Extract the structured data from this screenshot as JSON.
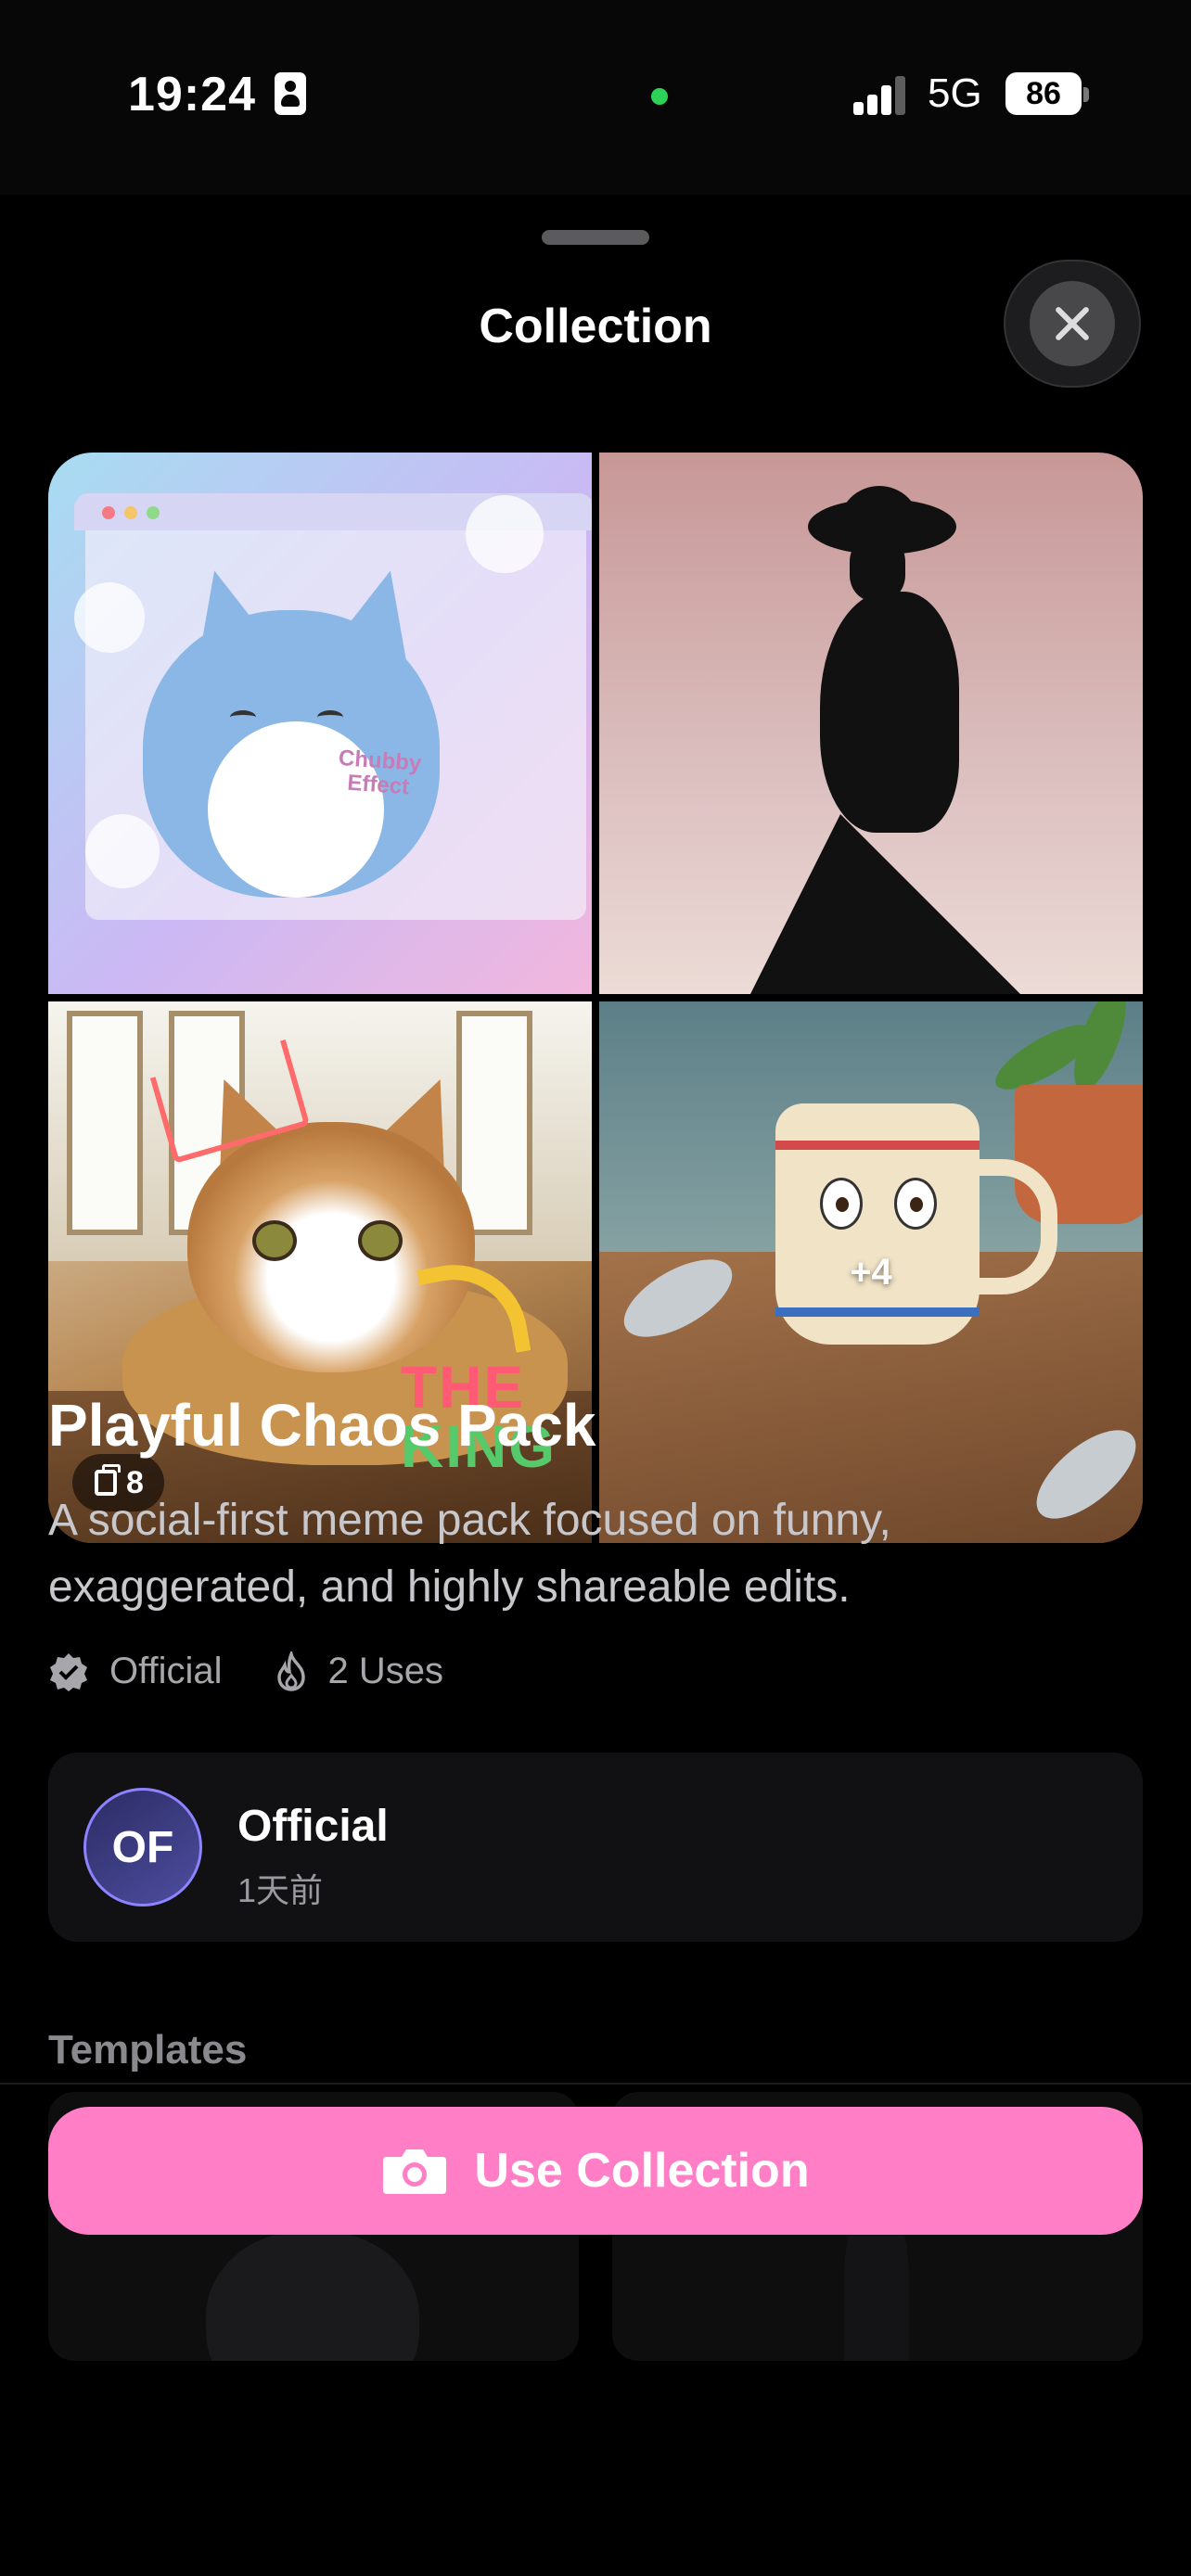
{
  "status_bar": {
    "time": "19:24",
    "network": "5G",
    "battery": "86"
  },
  "sheet": {
    "title": "Collection"
  },
  "collection": {
    "image_count": "8",
    "more_count": "+4",
    "tile3_text_line1": "THE",
    "tile3_text_line2": "KING",
    "tile1_text_line1": "Chubby",
    "tile1_text_line2": "Effect",
    "title": "Playful Chaos Pack",
    "description": "A social-first meme pack focused on funny, exaggerated, and highly shareable edits.",
    "badge_label": "Official",
    "uses_label": "2 Uses"
  },
  "author": {
    "initials": "OF",
    "name": "Official",
    "time": "1天前"
  },
  "templates": {
    "label": "Templates"
  },
  "cta": {
    "label": "Use Collection"
  },
  "colors": {
    "accent": "#ff7ec6",
    "avatar_ring": "#8d82ff",
    "status_dot": "#2ed158"
  },
  "icons": [
    "id-card-icon",
    "signal-icon",
    "battery-icon",
    "close-icon",
    "stack-icon",
    "verified-icon",
    "flame-icon",
    "camera-icon"
  ]
}
